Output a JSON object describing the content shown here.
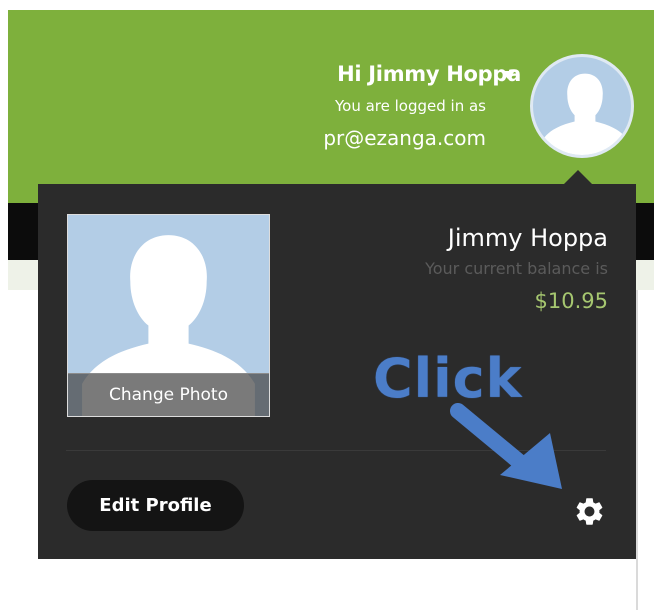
{
  "header": {
    "greeting": "Hi Jimmy Hoppa",
    "logged_in_label": "You are logged in as",
    "email": "pr@ezanga.com",
    "caret_icon": "caret-down-icon",
    "avatar_icon": "avatar-icon",
    "background_color": "#7eb03c"
  },
  "profile_panel": {
    "name": "Jimmy Hoppa",
    "balance_label": "Your current balance is",
    "balance_value": "$10.95",
    "change_photo_label": "Change Photo",
    "edit_profile_label": "Edit Profile",
    "settings_icon": "gear-icon",
    "background_color": "#2b2b2b",
    "balance_color": "#a6c770"
  },
  "annotation": {
    "text": "Click",
    "arrow_icon": "arrow-icon",
    "color": "#4b7dc8"
  }
}
